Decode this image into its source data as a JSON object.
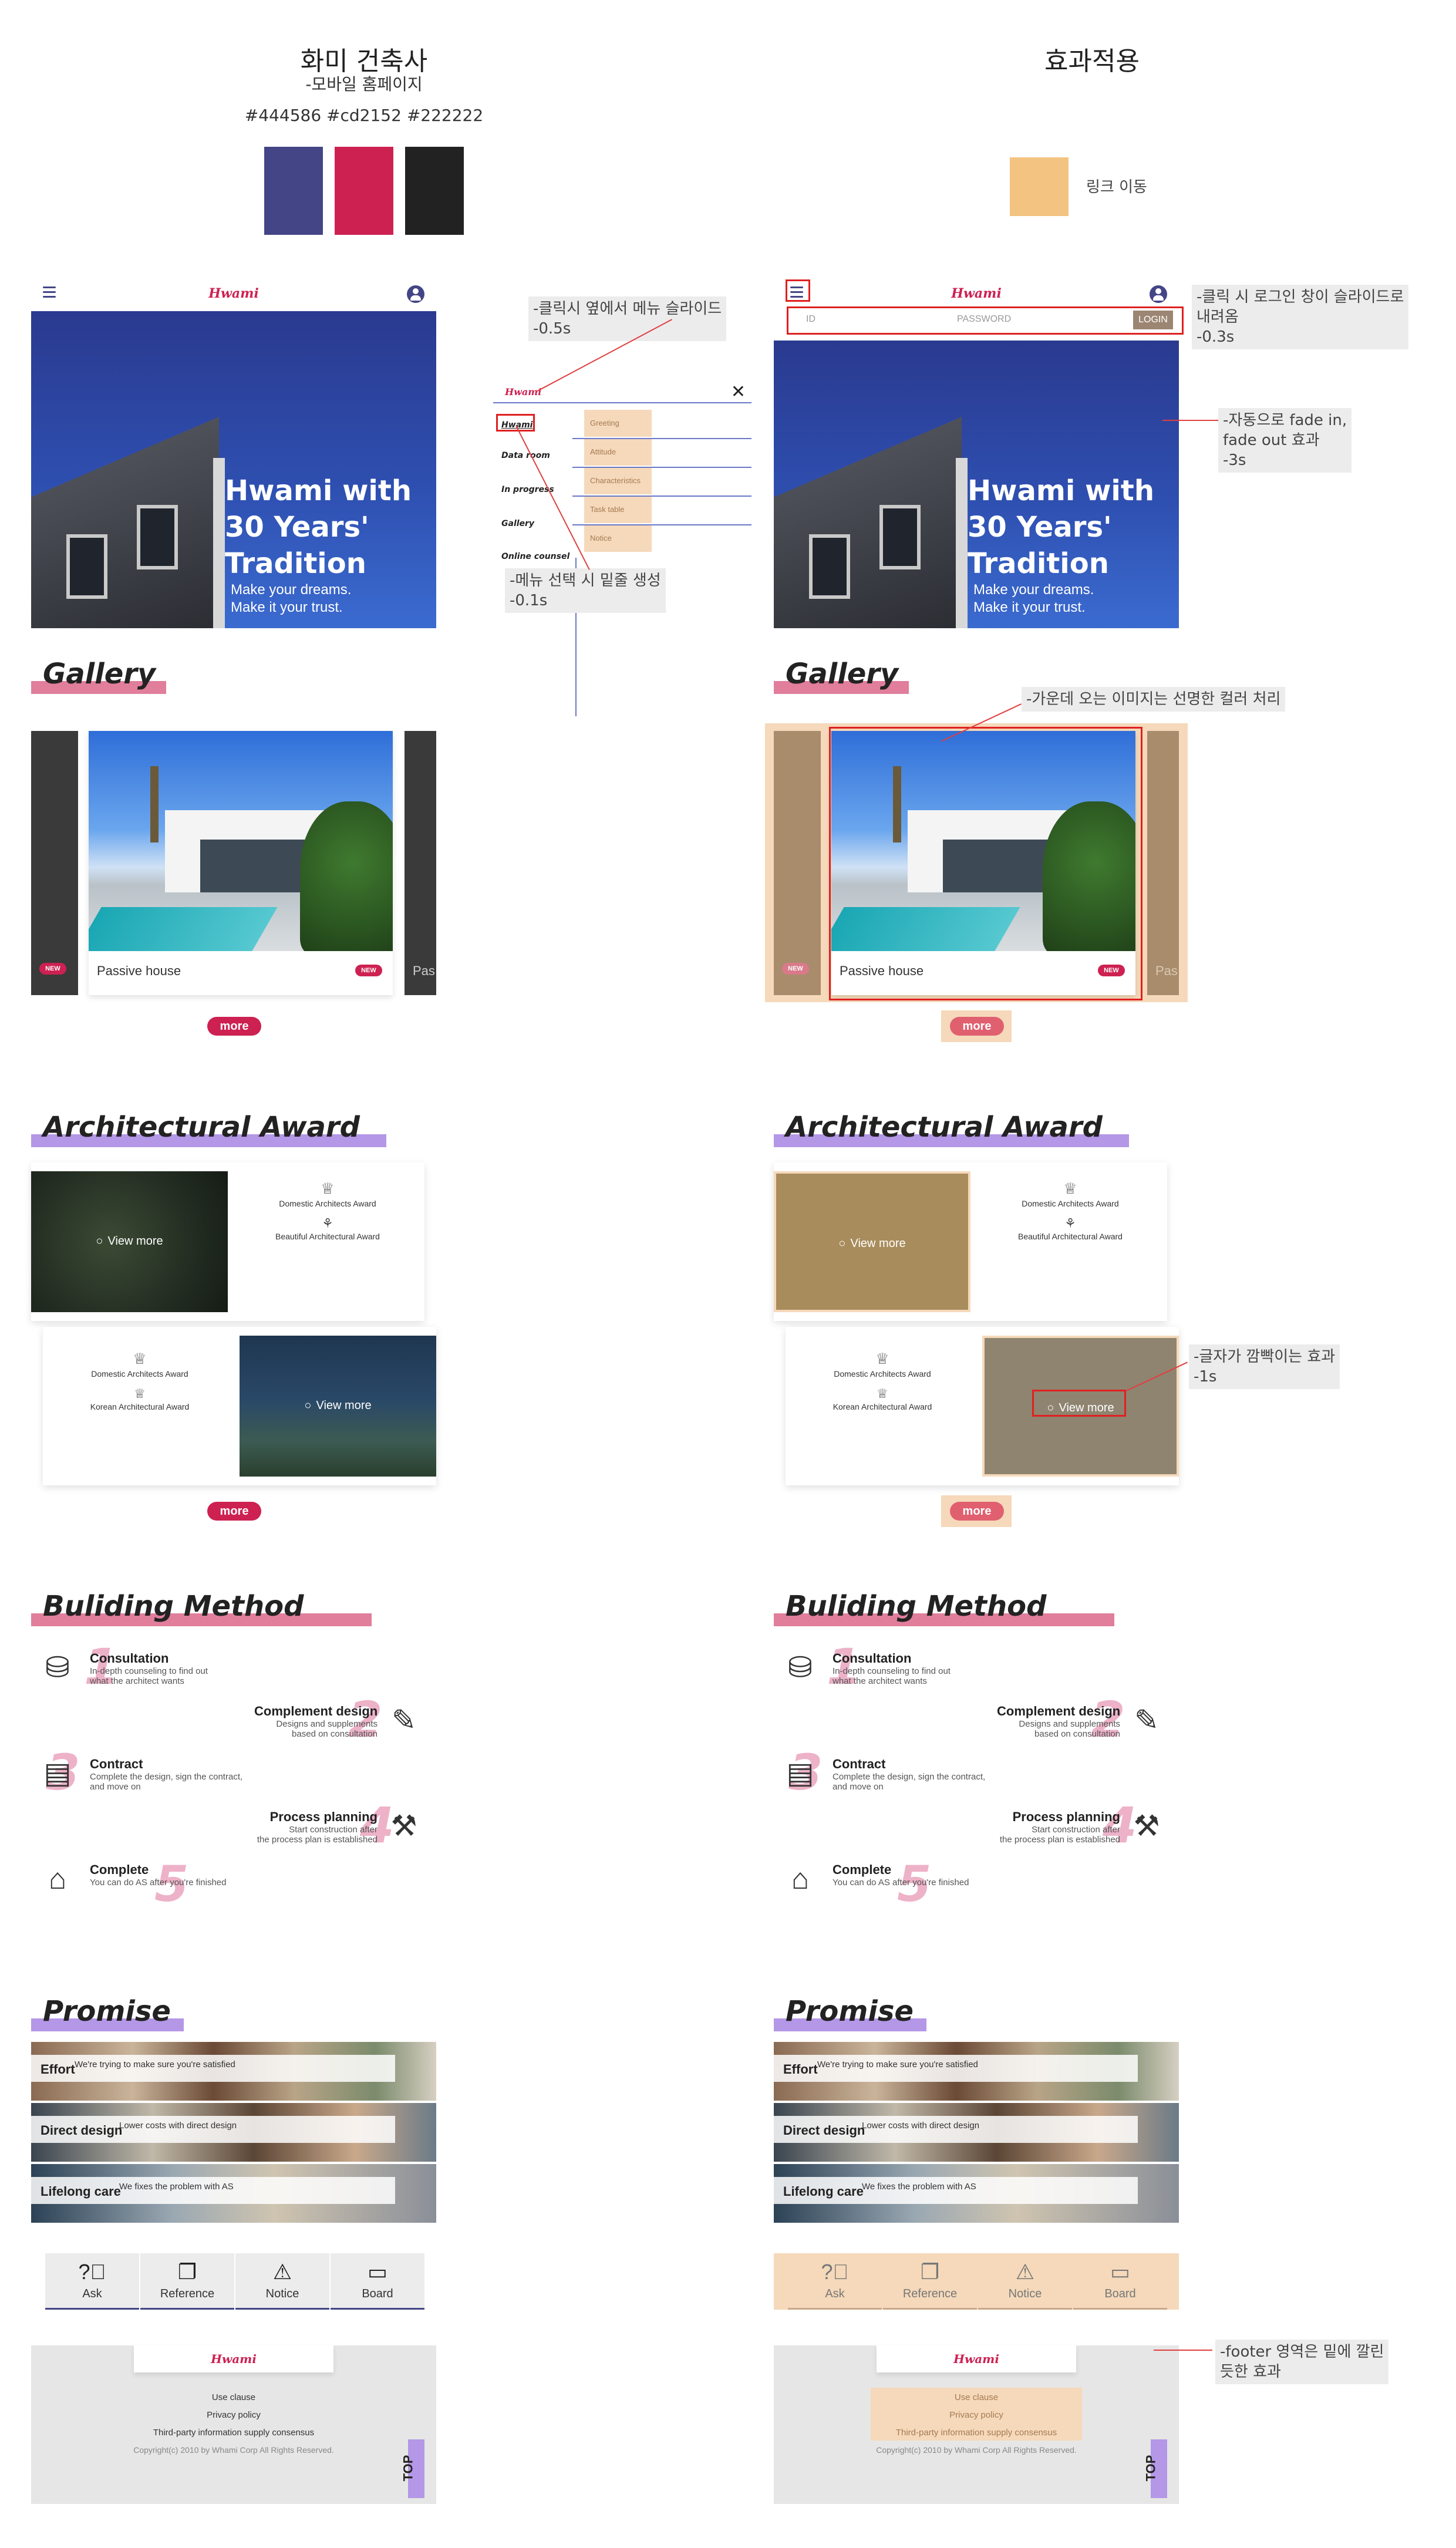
{
  "header": {
    "left_title": "화미 건축사",
    "left_subtitle": "-모바일 홈페이지",
    "colors_text": "#444586 #cd2152 #222222",
    "right_title": "효과적용",
    "link_label": "링크 이동"
  },
  "colors": {
    "primary": "#444586",
    "accent": "#cd2152",
    "dark": "#222222",
    "link": "#f3c381"
  },
  "app": {
    "logo": "Hwami",
    "hero": {
      "title": "Hwami with 30 Years' Tradition",
      "subtitle_line1": "Make your dreams.",
      "subtitle_line2": "Make it your trust."
    },
    "gallery": {
      "title": "Gallery",
      "caption": "Passive house",
      "next_caption": "Pas",
      "badge": "NEW",
      "more": "more"
    },
    "award": {
      "title": "Architectural Award",
      "view_more": "View more",
      "card1": [
        "Domestic Architects Award",
        "Beautiful Architectural Award"
      ],
      "card2": [
        "Domestic Architects Award",
        "Korean Architectural Award"
      ],
      "more": "more"
    },
    "method": {
      "title": "Buliding Method",
      "steps": [
        {
          "num": "1",
          "title": "Consultation",
          "desc1": "In-depth counseling to find out",
          "desc2": "what the architect wants",
          "icon": "meeting-icon"
        },
        {
          "num": "2",
          "title": "Complement design",
          "desc1": "Designs and supplements",
          "desc2": "based on consultation",
          "icon": "drawing-icon"
        },
        {
          "num": "3",
          "title": "Contract",
          "desc1": "Complete the design, sign the contract,",
          "desc2": "and move on",
          "icon": "contract-icon"
        },
        {
          "num": "4",
          "title": "Process planning",
          "desc1": "Start construction after",
          "desc2": "the process plan is established",
          "icon": "tools-icon"
        },
        {
          "num": "5",
          "title": "Complete",
          "desc1": "You can do AS after you're finished",
          "desc2": "",
          "icon": "house-icon"
        }
      ]
    },
    "promise": {
      "title": "Promise",
      "items": [
        {
          "title": "Effort",
          "desc": "We're trying to make sure you're satisfied"
        },
        {
          "title": "Direct design",
          "desc": "Lower costs with direct design"
        },
        {
          "title": "Lifelong care",
          "desc": "We fixes the problem with AS"
        }
      ]
    },
    "quicknav": [
      {
        "label": "Ask",
        "icon": "question-icon"
      },
      {
        "label": "Reference",
        "icon": "book-icon"
      },
      {
        "label": "Notice",
        "icon": "warning-icon"
      },
      {
        "label": "Board",
        "icon": "board-icon"
      }
    ],
    "footer": {
      "links": [
        "Use clause",
        "Privacy policy",
        "Third-party information supply consensus"
      ],
      "copyright": "Copyright(c) 2010 by Whami Corp All Rights Reserved.",
      "top": "TOP"
    }
  },
  "menu": {
    "items": [
      "Hwami",
      "Data room",
      "In progress",
      "Gallery",
      "Online counsel"
    ],
    "subitems": [
      "Greeting",
      "Attitude",
      "Characteristics",
      "Task table",
      "Notice"
    ]
  },
  "login": {
    "id_placeholder": "ID",
    "pw_placeholder": "PASSWORD",
    "button": "LOGIN"
  },
  "notes": {
    "menu_slide_1": "-클릭시 옆에서 메뉴 슬라이드",
    "menu_slide_2": "-0.5s",
    "underline_1": "-메뉴 선택 시 밑줄 생성",
    "underline_2": "-0.1s",
    "login_1": "-클릭 시 로그인 창이 슬라이드로",
    "login_2": "내려옴",
    "login_3": "-0.3s",
    "fade_1": "-자동으로 fade in,",
    "fade_2": "fade out 효과",
    "fade_3": "-3s",
    "gallery_center": "-가운데 오는 이미지는 선명한 컬러 처리",
    "blink_1": "-글자가 깜빡이는 효과",
    "blink_2": "-1s",
    "footer_1": "-footer 영역은 밑에 깔린",
    "footer_2": "듯한 효과"
  }
}
